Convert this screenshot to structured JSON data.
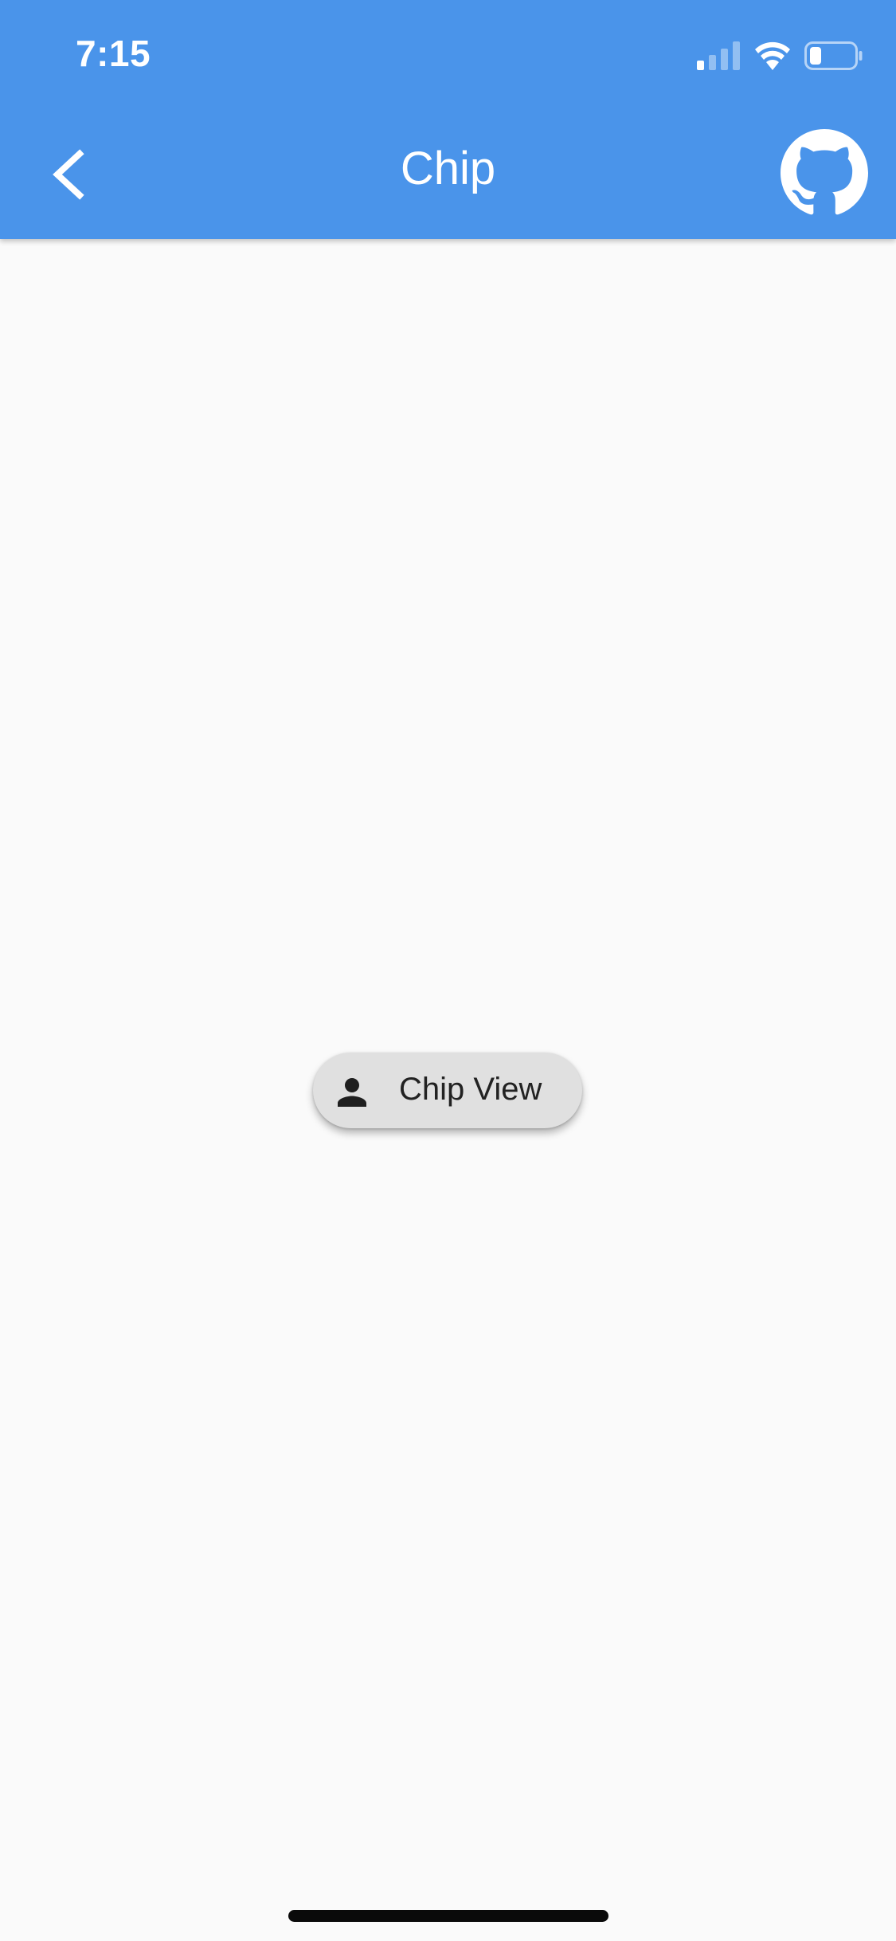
{
  "colors": {
    "app_bar": "#4a94ea",
    "background": "#fafafa",
    "chip_background": "#e0e0e0",
    "chip_text": "#222222",
    "header_text": "#ffffff"
  },
  "status_bar": {
    "time": "7:15",
    "icons": [
      "signal-icon",
      "wifi-icon",
      "battery-icon"
    ]
  },
  "app_bar": {
    "title": "Chip",
    "back_icon": "chevron-left-icon",
    "action_icon": "github-icon"
  },
  "chip": {
    "label": "Chip View",
    "avatar_icon": "person-icon"
  }
}
